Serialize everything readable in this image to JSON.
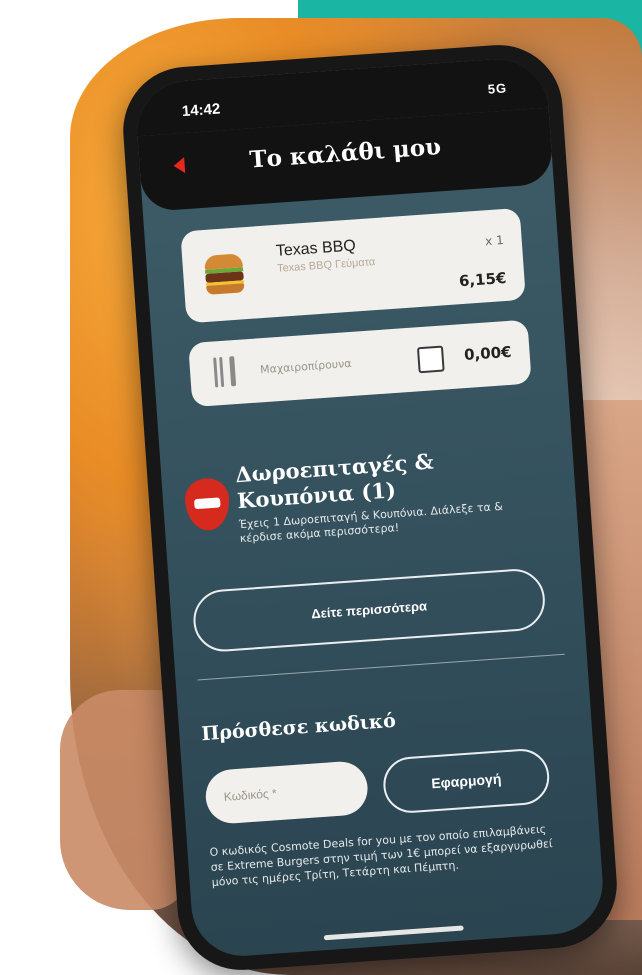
{
  "status_bar": {
    "time": "14:42",
    "signal": "5G"
  },
  "header": {
    "title": "Το καλάθι μου"
  },
  "cart_item": {
    "name": "Texas BBQ",
    "subtitle": "Texas BBQ Γεύματα",
    "quantity": "x 1",
    "price": "6,15€"
  },
  "cutlery": {
    "label": "Μαχαιροπίρουνα",
    "price": "0,00€",
    "checked": false
  },
  "coupons": {
    "title": "Δωροεπιταγές & Κουπόνια (1)",
    "description": "Έχεις 1 Δωροεπιταγή & Κουπόνια. Διάλεξε τα & κέρδισε ακόμα περισσότερα!",
    "see_more_label": "Δείτε περισσότερα"
  },
  "promo_code": {
    "heading": "Πρόσθεσε κωδικό",
    "input_placeholder": "Κωδικός *",
    "apply_label": "Εφαρμογή",
    "note": "Ο κωδικός Cosmote Deals for you με τον οποίο επιλαμβάνεις σε Extreme Burgers στην τιμή των 1€ μπορεί να εξαργυρωθεί μόνο τις ημέρες Τρίτη, Τετάρτη και Πέμπτη."
  },
  "colors": {
    "accent_red": "#e8271f",
    "screen_bg": "#3a5864",
    "card_bg": "#f2f0ec",
    "teal_corner": "#1bb5a4"
  }
}
